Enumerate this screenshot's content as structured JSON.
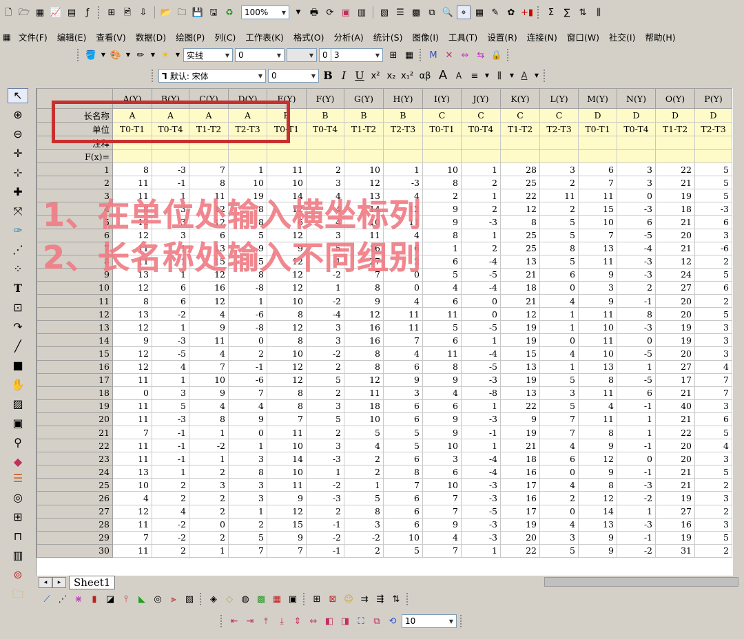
{
  "toolbar1": {
    "zoom": "100%",
    "icons": [
      "new-icon",
      "open-icon",
      "new-workbook-icon",
      "new-graph-icon",
      "new-matrix-icon",
      "new-function-icon",
      "new-excel-icon",
      "open-template-icon",
      "save-icon",
      "save-project-icon",
      "save-template-icon",
      "import-icon",
      "zoom-select-icon",
      "print-icon",
      "refresh-icon",
      "duplicate-icon",
      "column-icon",
      "grid-icon",
      "layer-icon",
      "hierarchy-icon",
      "zoom-icon",
      "data-reader-icon",
      "notes-icon",
      "palette-icon",
      "add-column-icon",
      "sigma-column-icon",
      "sigma-row-icon",
      "sort-icon",
      "bars-icon"
    ]
  },
  "menu": [
    "文件(F)",
    "编辑(E)",
    "查看(V)",
    "数据(D)",
    "绘图(P)",
    "列(C)",
    "工作表(K)",
    "格式(O)",
    "分析(A)",
    "统计(S)",
    "图像(I)",
    "工具(T)",
    "设置(R)",
    "连接(N)",
    "窗口(W)",
    "社交(I)",
    "帮助(H)"
  ],
  "format_toolbar": {
    "line_style": "实线",
    "line_width": "0",
    "value2": "0",
    "value3": "3"
  },
  "font_toolbar": {
    "font": "默认: 宋体",
    "size": "0",
    "buttons": [
      "B",
      "I",
      "U",
      "x²",
      "x₂",
      "x₁²",
      "αβ",
      "A",
      "A"
    ]
  },
  "grid": {
    "column_headers": [
      "A(Y)",
      "B(Y)",
      "C(Y)",
      "D(Y)",
      "E(Y)",
      "F(Y)",
      "G(Y)",
      "H(Y)",
      "I(Y)",
      "J(Y)",
      "K(Y)",
      "L(Y)",
      "M(Y)",
      "N(Y)",
      "O(Y)",
      "P(Y)"
    ],
    "meta_labels": {
      "long_name": "长名称",
      "units": "单位",
      "comments": "注释",
      "fx": "F(x)="
    },
    "long_names": [
      "A",
      "A",
      "A",
      "A",
      "B",
      "B",
      "B",
      "B",
      "C",
      "C",
      "C",
      "C",
      "D",
      "D",
      "D",
      "D"
    ],
    "units": [
      "T0-T1",
      "T0-T4",
      "T1-T2",
      "T2-T3",
      "T0-T1",
      "T0-T4",
      "T1-T2",
      "T2-T3",
      "T0-T1",
      "T0-T4",
      "T1-T2",
      "T2-T3",
      "T0-T1",
      "T0-T4",
      "T1-T2",
      "T2-T3"
    ],
    "rows": [
      [
        "1",
        "8",
        "-3",
        "7",
        "1",
        "11",
        "2",
        "10",
        "1",
        "10",
        "1",
        "28",
        "3",
        "6",
        "3",
        "22",
        "5"
      ],
      [
        "2",
        "11",
        "-1",
        "8",
        "10",
        "10",
        "3",
        "12",
        "-3",
        "8",
        "2",
        "25",
        "2",
        "7",
        "3",
        "21",
        "5"
      ],
      [
        "3",
        "11",
        "1",
        "11",
        "19",
        "14",
        "4",
        "13",
        "4",
        "2",
        "1",
        "22",
        "11",
        "11",
        "0",
        "19",
        "5"
      ],
      [
        "4",
        "8",
        "3",
        "12",
        "8",
        "12",
        "4",
        "14",
        "12",
        "9",
        "2",
        "12",
        "2",
        "15",
        "-3",
        "18",
        "-3"
      ],
      [
        "5",
        "12",
        "3",
        "12",
        "8",
        "6",
        "4",
        "10",
        "11",
        "9",
        "-3",
        "8",
        "5",
        "10",
        "6",
        "21",
        "6"
      ],
      [
        "6",
        "12",
        "3",
        "6",
        "5",
        "12",
        "3",
        "11",
        "4",
        "8",
        "1",
        "25",
        "5",
        "7",
        "-5",
        "20",
        "3"
      ],
      [
        "7",
        "11",
        "1",
        "13",
        "9",
        "9",
        "5",
        "16",
        "6",
        "1",
        "2",
        "25",
        "8",
        "13",
        "-4",
        "21",
        "-6"
      ],
      [
        "8",
        "11",
        "1",
        "15",
        "5",
        "12",
        "-1",
        "27",
        "2",
        "6",
        "-4",
        "13",
        "5",
        "11",
        "-3",
        "12",
        "2"
      ],
      [
        "9",
        "13",
        "1",
        "12",
        "8",
        "12",
        "-2",
        "7",
        "0",
        "5",
        "-5",
        "21",
        "6",
        "9",
        "-3",
        "24",
        "5"
      ],
      [
        "10",
        "12",
        "6",
        "16",
        "-8",
        "12",
        "1",
        "8",
        "0",
        "4",
        "-4",
        "18",
        "0",
        "3",
        "2",
        "27",
        "6"
      ],
      [
        "11",
        "8",
        "6",
        "12",
        "1",
        "10",
        "-2",
        "9",
        "4",
        "6",
        "0",
        "21",
        "4",
        "9",
        "-1",
        "20",
        "2"
      ],
      [
        "12",
        "13",
        "-2",
        "4",
        "-6",
        "8",
        "-4",
        "12",
        "11",
        "11",
        "0",
        "12",
        "1",
        "11",
        "8",
        "20",
        "5"
      ],
      [
        "13",
        "12",
        "1",
        "9",
        "-8",
        "12",
        "3",
        "16",
        "11",
        "5",
        "-5",
        "19",
        "1",
        "10",
        "-3",
        "19",
        "3"
      ],
      [
        "14",
        "9",
        "-3",
        "11",
        "0",
        "8",
        "3",
        "16",
        "7",
        "6",
        "1",
        "19",
        "0",
        "11",
        "0",
        "19",
        "3"
      ],
      [
        "15",
        "12",
        "-5",
        "4",
        "2",
        "10",
        "-2",
        "8",
        "4",
        "11",
        "-4",
        "15",
        "4",
        "10",
        "-5",
        "20",
        "3"
      ],
      [
        "16",
        "12",
        "4",
        "7",
        "-1",
        "12",
        "2",
        "8",
        "6",
        "8",
        "-5",
        "13",
        "1",
        "13",
        "1",
        "27",
        "4"
      ],
      [
        "17",
        "11",
        "1",
        "10",
        "-6",
        "12",
        "5",
        "12",
        "9",
        "9",
        "-3",
        "19",
        "5",
        "8",
        "-5",
        "17",
        "7"
      ],
      [
        "18",
        "0",
        "3",
        "9",
        "7",
        "8",
        "2",
        "11",
        "3",
        "4",
        "-8",
        "13",
        "3",
        "11",
        "6",
        "21",
        "7"
      ],
      [
        "19",
        "11",
        "5",
        "4",
        "4",
        "8",
        "3",
        "18",
        "6",
        "6",
        "1",
        "22",
        "5",
        "4",
        "-1",
        "40",
        "3"
      ],
      [
        "20",
        "11",
        "-3",
        "8",
        "9",
        "7",
        "5",
        "10",
        "6",
        "9",
        "-3",
        "9",
        "7",
        "11",
        "1",
        "21",
        "6"
      ],
      [
        "21",
        "7",
        "-1",
        "1",
        "0",
        "11",
        "2",
        "5",
        "5",
        "9",
        "-1",
        "19",
        "7",
        "8",
        "1",
        "22",
        "5"
      ],
      [
        "22",
        "11",
        "-1",
        "-2",
        "1",
        "10",
        "3",
        "4",
        "5",
        "10",
        "1",
        "21",
        "4",
        "9",
        "-1",
        "20",
        "4"
      ],
      [
        "23",
        "11",
        "-1",
        "1",
        "3",
        "14",
        "-3",
        "2",
        "6",
        "3",
        "-4",
        "18",
        "6",
        "12",
        "0",
        "20",
        "3"
      ],
      [
        "24",
        "13",
        "1",
        "2",
        "8",
        "10",
        "1",
        "2",
        "8",
        "6",
        "-4",
        "16",
        "0",
        "9",
        "-1",
        "21",
        "5"
      ],
      [
        "25",
        "10",
        "2",
        "3",
        "3",
        "11",
        "-2",
        "1",
        "7",
        "10",
        "-3",
        "17",
        "4",
        "8",
        "-3",
        "21",
        "2"
      ],
      [
        "26",
        "4",
        "2",
        "2",
        "3",
        "9",
        "-3",
        "5",
        "6",
        "7",
        "-3",
        "16",
        "2",
        "12",
        "-2",
        "19",
        "3"
      ],
      [
        "27",
        "12",
        "4",
        "2",
        "1",
        "12",
        "2",
        "8",
        "6",
        "7",
        "-5",
        "17",
        "0",
        "14",
        "1",
        "27",
        "2"
      ],
      [
        "28",
        "11",
        "-2",
        "0",
        "2",
        "15",
        "-1",
        "3",
        "6",
        "9",
        "-3",
        "19",
        "4",
        "13",
        "-3",
        "16",
        "3"
      ],
      [
        "29",
        "7",
        "-2",
        "2",
        "5",
        "9",
        "-2",
        "-2",
        "10",
        "4",
        "-3",
        "20",
        "3",
        "9",
        "-1",
        "19",
        "5"
      ],
      [
        "30",
        "11",
        "2",
        "1",
        "7",
        "7",
        "-1",
        "2",
        "5",
        "7",
        "1",
        "22",
        "5",
        "9",
        "-2",
        "31",
        "2"
      ]
    ]
  },
  "annotations": {
    "line1": "1、在单位处输入横坐标列",
    "line2": "2、长名称处输入不同组别"
  },
  "sheet_tab": "Sheet1",
  "bottom_toolbar": {
    "value": "10"
  }
}
